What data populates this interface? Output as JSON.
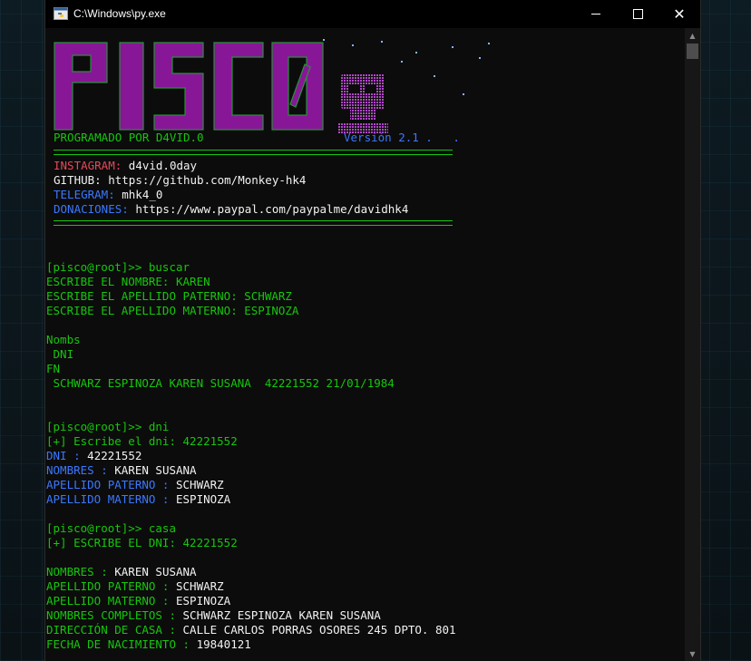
{
  "window": {
    "title": "C:\\Windows\\py.exe"
  },
  "banner": {
    "logo_text": "PISCO",
    "programmed_by": "PROGRAMADO POR D4VID.0",
    "version": "Versión 2.1 .   ."
  },
  "info": {
    "instagram_label": "INSTAGRAM:",
    "instagram_value": " d4vid.0day",
    "github_label": "GITHUB:",
    "github_value": " https://github.com/Monkey-hk4",
    "telegram_label": "TELEGRAM:",
    "telegram_value": " mhk4_0",
    "donations_label": "DONACIONES:",
    "donations_value": " https://www.paypal.com/paypalme/davidhk4"
  },
  "session": {
    "buscar": {
      "prompt": "[pisco@root]>> buscar",
      "nombre": "ESCRIBE EL NOMBRE: KAREN",
      "paterno": "ESCRIBE EL APELLIDO PATERNO: SCHWARZ",
      "materno": "ESCRIBE EL APELLIDO MATERNO: ESPINOZA",
      "h1": "Nombs",
      "h2": " DNI",
      "h3": "FN",
      "result": " SCHWARZ ESPINOZA KAREN SUSANA  42221552 21/01/1984"
    },
    "dni": {
      "prompt": "[pisco@root]>> dni",
      "ask": "[+] Escribe el dni: 42221552",
      "dni_label": "DNI :",
      "dni_value": " 42221552",
      "nombres_label": "NOMBRES :",
      "nombres_value": " KAREN SUSANA",
      "paterno_label": "APELLIDO PATERNO :",
      "paterno_value": " SCHWARZ",
      "materno_label": "APELLIDO MATERNO :",
      "materno_value": " ESPINOZA"
    },
    "casa": {
      "prompt": "[pisco@root]>> casa",
      "ask": "[+] ESCRIBE EL DNI: 42221552",
      "nombres_label": "NOMBRES :",
      "nombres_value": " KAREN SUSANA",
      "paterno_label": "APELLIDO PATERNO :",
      "paterno_value": " SCHWARZ",
      "materno_label": "APELLIDO MATERNO :",
      "materno_value": " ESPINOZA",
      "completos_label": "NOMBRES COMPLETOS :",
      "completos_value": " SCHWARZ ESPINOZA KAREN SUSANA",
      "direccion_label": "DIRECCIÓN DE CASA :",
      "direccion_value": " CALLE CARLOS PORRAS OSORES 245 DPTO. 801",
      "nacimiento_label": "FECHA DE NACIMIENTO :",
      "nacimiento_value": " 19840121"
    }
  },
  "colors": {
    "green": "#16c60c",
    "blue": "#3b78ff",
    "red": "#e74856",
    "purple": "#881798",
    "background": "#0c0c0c"
  }
}
